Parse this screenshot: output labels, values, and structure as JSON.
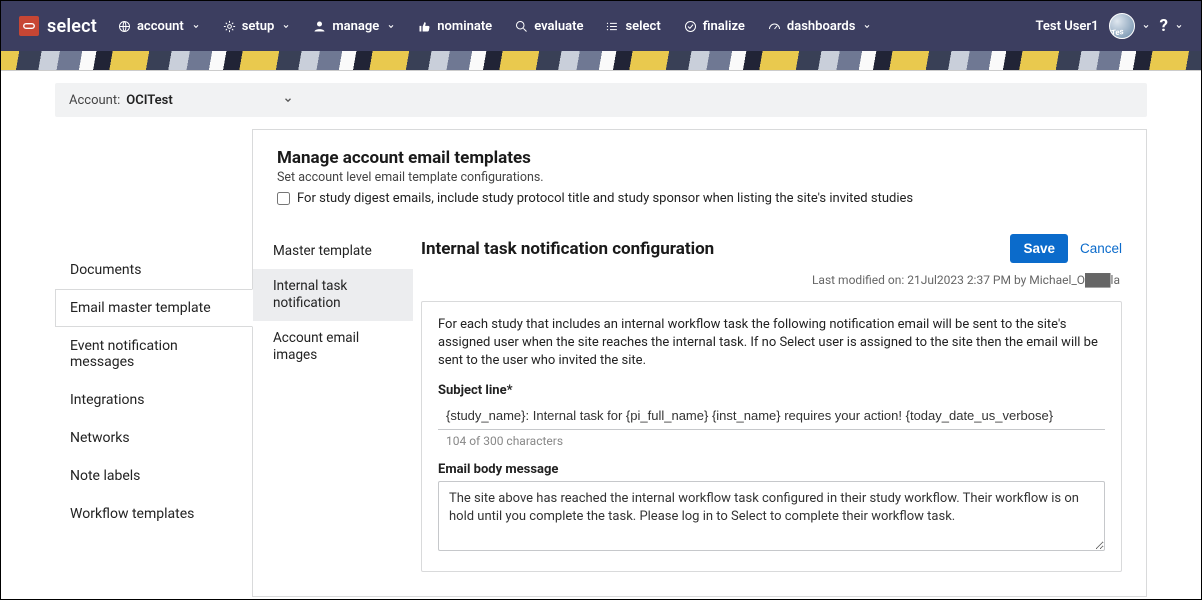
{
  "brand": {
    "text": "select"
  },
  "nav": [
    {
      "key": "account",
      "label": "account",
      "hasCaret": true
    },
    {
      "key": "setup",
      "label": "setup",
      "hasCaret": true
    },
    {
      "key": "manage",
      "label": "manage",
      "hasCaret": true
    },
    {
      "key": "nominate",
      "label": "nominate",
      "hasCaret": false
    },
    {
      "key": "evaluate",
      "label": "evaluate",
      "hasCaret": false
    },
    {
      "key": "select",
      "label": "select",
      "hasCaret": false
    },
    {
      "key": "finalize",
      "label": "finalize",
      "hasCaret": false
    },
    {
      "key": "dashboards",
      "label": "dashboards",
      "hasCaret": true
    }
  ],
  "user": {
    "name": "Test User1"
  },
  "account_bar": {
    "label": "Account:",
    "value": "OCITest"
  },
  "side_nav": [
    "Documents",
    "Email master template",
    "Event notification messages",
    "Integrations",
    "Networks",
    "Note labels",
    "Workflow templates"
  ],
  "side_nav_active": 1,
  "page": {
    "title": "Manage account email templates",
    "subtitle": "Set account level email template configurations.",
    "digest_checkbox_label": "For study digest emails, include study protocol title and study sponsor when listing the site's invited studies",
    "digest_checked": false
  },
  "inner_nav": [
    "Master template",
    "Internal task notification",
    "Account email images"
  ],
  "inner_nav_active": 1,
  "detail": {
    "title": "Internal task notification configuration",
    "save_label": "Save",
    "cancel_label": "Cancel",
    "last_modified": "Last modified on: 21Jul2023 2:37 PM by Michael_O███la",
    "description": "For each study that includes an internal workflow task the following notification email will be sent to the site's assigned user when the site reaches the internal task. If no Select user is assigned to the site then the email will be sent to the user who invited the site.",
    "subject_label": "Subject line*",
    "subject_value": "{study_name}: Internal task for {pi_full_name} {inst_name} requires your action! {today_date_us_verbose}",
    "subject_counter": "104 of 300 characters",
    "body_label": "Email body message",
    "body_value": "The site above has reached the internal workflow task configured in their study workflow. Their workflow is on hold until you complete the task. Please log in to Select to complete their workflow task."
  }
}
